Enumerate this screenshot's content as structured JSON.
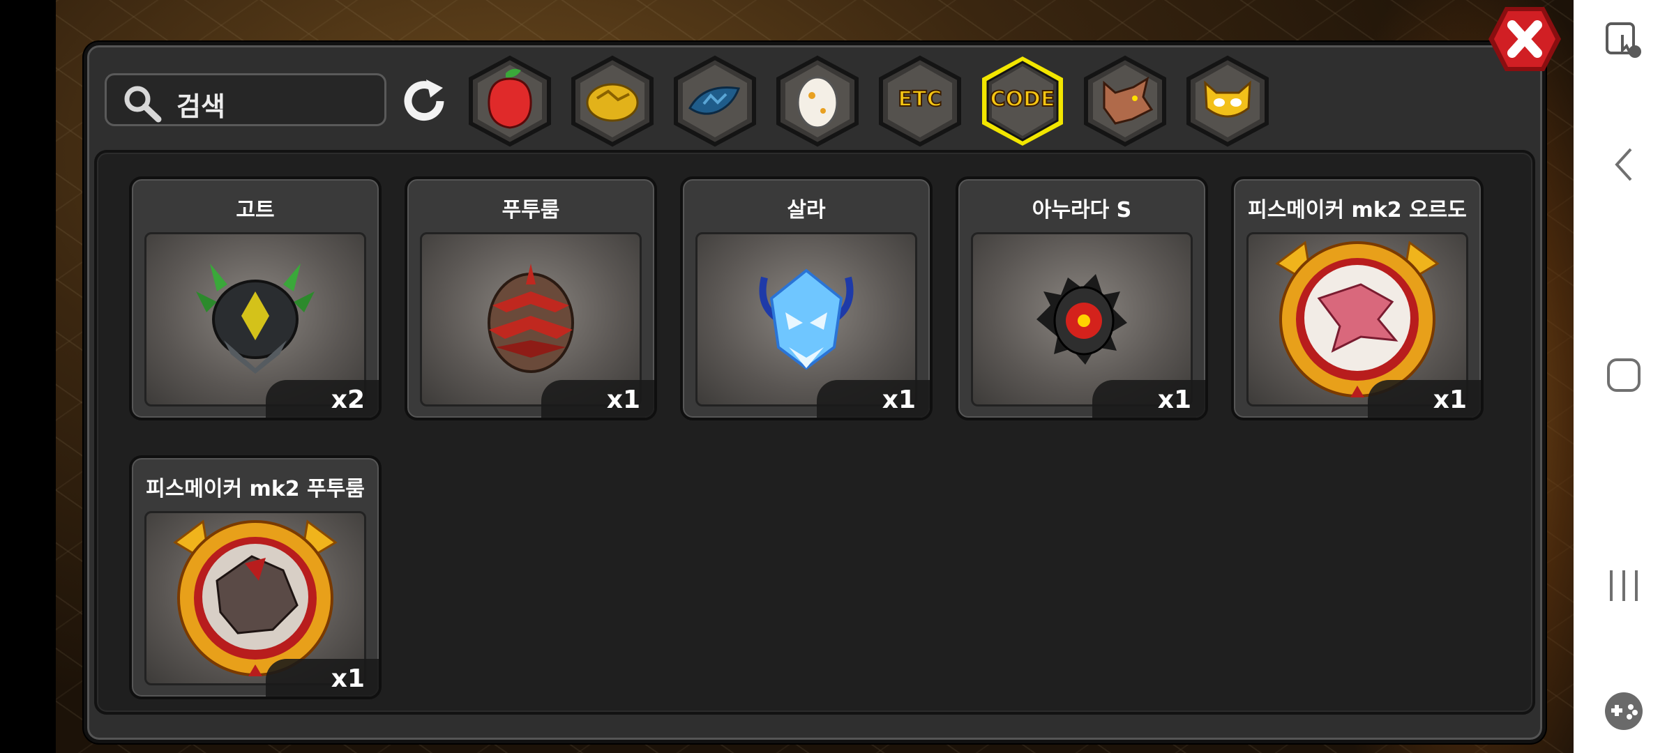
{
  "search": {
    "label": "검색"
  },
  "tabs": [
    {
      "name": "fruit",
      "icon": "red-fruit-icon"
    },
    {
      "name": "ore",
      "icon": "gold-ore-icon"
    },
    {
      "name": "scale",
      "icon": "blue-scale-icon"
    },
    {
      "name": "egg",
      "icon": "egg-icon"
    },
    {
      "name": "etc",
      "label": "ETC"
    },
    {
      "name": "code",
      "label": "CODE",
      "selected": true
    },
    {
      "name": "wolf",
      "icon": "wolf-head-icon"
    },
    {
      "name": "monster",
      "icon": "yellow-monster-icon"
    }
  ],
  "items": [
    {
      "title": "고트",
      "qty": "x2",
      "icon": "goat-armored-helmet-icon"
    },
    {
      "title": "푸투룸",
      "qty": "x1",
      "icon": "red-spiked-egg-icon"
    },
    {
      "title": "살라",
      "qty": "x1",
      "icon": "blue-ice-beast-icon"
    },
    {
      "title": "아누라다 S",
      "qty": "x1",
      "icon": "dark-spiked-orb-icon"
    },
    {
      "title": "피스메이커 mk2 오르도",
      "qty": "x1",
      "icon": "gold-emblem-pink-dragon-icon"
    },
    {
      "title": "피스메이커 mk2 푸투룸",
      "qty": "x1",
      "icon": "gold-emblem-dark-beast-icon"
    }
  ],
  "colors": {
    "selected_tab": "#f2e600",
    "tab_text": "#f5c613",
    "close_red": "#d11f24"
  }
}
